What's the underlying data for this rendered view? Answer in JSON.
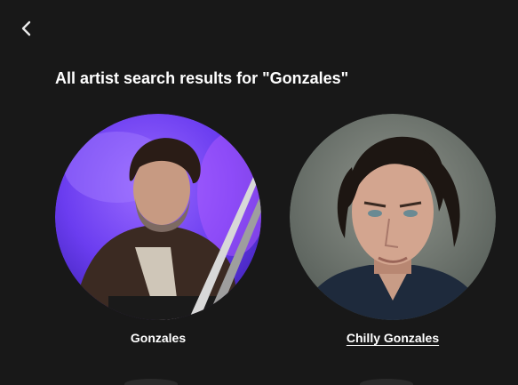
{
  "header": {
    "back_icon": "chevron-left-icon",
    "title": "All artist search results for \"Gonzales\""
  },
  "results": [
    {
      "name": "Gonzales",
      "image": "artist-photo-gonzales",
      "underlined": false
    },
    {
      "name": "Chilly Gonzales",
      "image": "artist-photo-chilly-gonzales",
      "underlined": true
    }
  ],
  "colors": {
    "background": "#181818",
    "text": "#ffffff",
    "accent_purple": "#7a4bff"
  }
}
